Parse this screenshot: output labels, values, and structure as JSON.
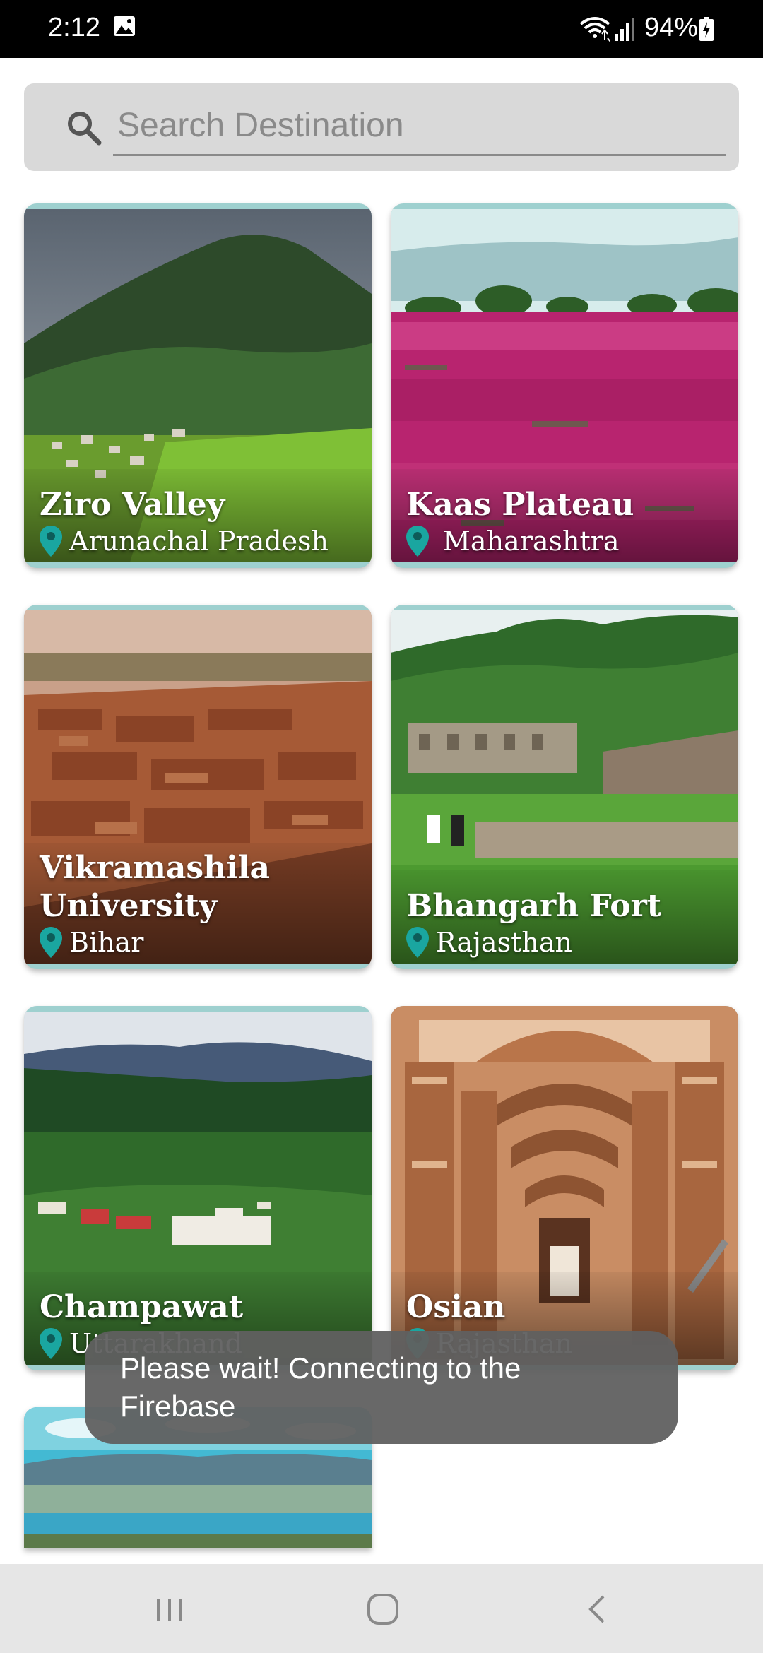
{
  "status_bar": {
    "time": "2:12",
    "battery": "94%",
    "icons": [
      "gallery-icon",
      "wifi-icon",
      "signal-icon",
      "battery-icon"
    ]
  },
  "search": {
    "placeholder": "Search Destination",
    "icon": "search-icon"
  },
  "destinations": [
    {
      "name": "Ziro Valley",
      "state": "Arunachal Pradesh"
    },
    {
      "name": "Kaas Plateau",
      "state": "Maharashtra"
    },
    {
      "name": "Vikramashila University",
      "state": "Bihar"
    },
    {
      "name": "Bhangarh Fort",
      "state": "Rajasthan"
    },
    {
      "name": "Champawat",
      "state": "Uttarakhand"
    },
    {
      "name": "Osian",
      "state": "Rajasthan"
    },
    {
      "name": "",
      "state": ""
    }
  ],
  "toast": {
    "message": "Please wait! Connecting to the Firebase"
  },
  "nav_bar": {
    "buttons": [
      "recent-apps-icon",
      "home-icon",
      "back-icon"
    ]
  },
  "colors": {
    "card_frame": "#9ed0cf",
    "pin": "#1aa6a0",
    "search_bg": "#d9d9d9",
    "toast_bg": "#606060"
  }
}
